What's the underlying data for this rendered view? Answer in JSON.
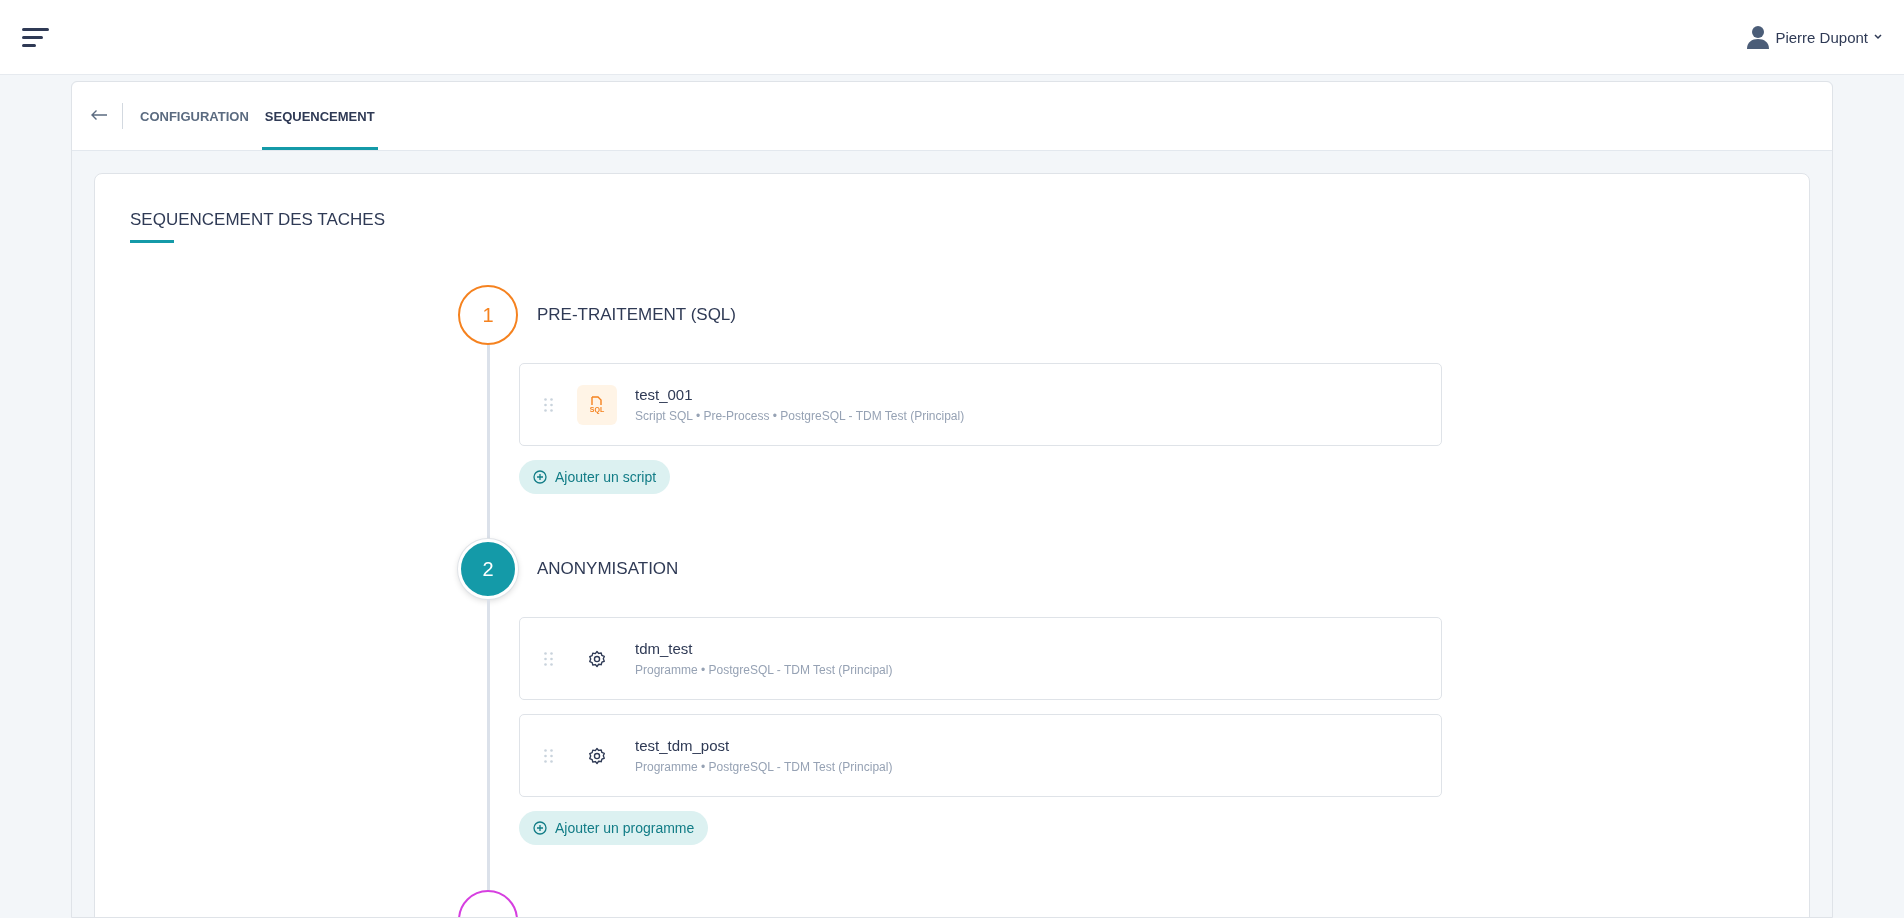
{
  "header": {
    "user_name": "Pierre Dupont"
  },
  "tabs": [
    {
      "label": "CONFIGURATION",
      "selected": false
    },
    {
      "label": "SEQUENCEMENT",
      "selected": true
    }
  ],
  "section_title": "SEQUENCEMENT DES TACHES",
  "steps": [
    {
      "number": "1",
      "title": "PRE-TRAITEMENT (SQL)",
      "color": "#f5821f",
      "active": false,
      "items": [
        {
          "kind": "sql",
          "icon_text": "SQL",
          "name": "test_001",
          "details": "Script SQL • Pre-Process • PostgreSQL - TDM Test (Principal)"
        }
      ],
      "add_button": "Ajouter un script"
    },
    {
      "number": "2",
      "title": "ANONYMISATION",
      "color": "#149aa8",
      "active": true,
      "items": [
        {
          "kind": "program",
          "name": "tdm_test",
          "details": "Programme • PostgreSQL - TDM Test (Principal)"
        },
        {
          "kind": "program",
          "name": "test_tdm_post",
          "details": "Programme • PostgreSQL - TDM Test (Principal)"
        }
      ],
      "add_button": "Ajouter un programme"
    },
    {
      "color": "#d63fe0",
      "active": false
    }
  ]
}
